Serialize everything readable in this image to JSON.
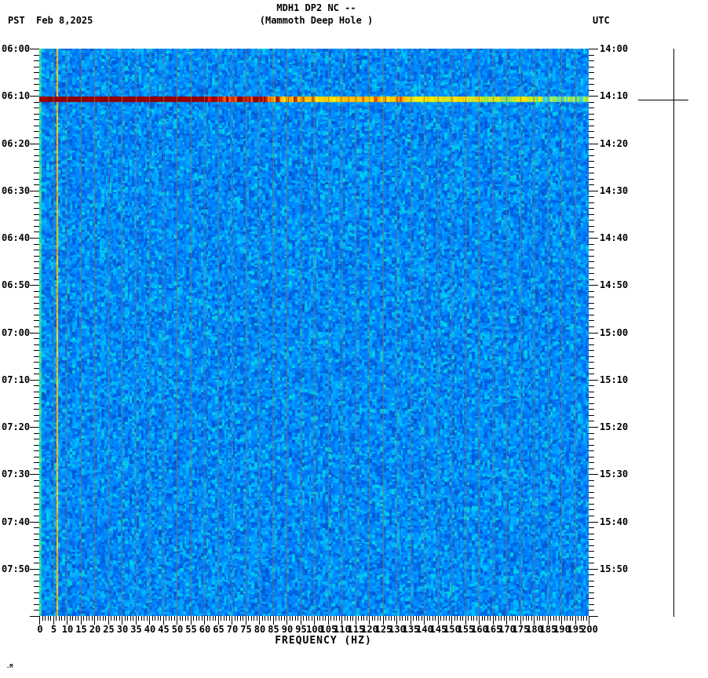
{
  "header": {
    "pst_date_line": "PST  Feb 8,2025",
    "timezone_left": "PST",
    "date": "Feb 8,2025",
    "title_line1": "MDH1 DP2 NC --",
    "title_line2": "(Mammoth Deep Hole )",
    "timezone_right": "UTC"
  },
  "footer": {
    "mark": ".M"
  },
  "chart_data": {
    "type": "heatmap",
    "subtype": "seismic-spectrogram",
    "title": "MDH1 DP2 NC --",
    "subtitle": "(Mammoth Deep Hole )",
    "xlabel": "FREQUENCY (HZ)",
    "x_range_hz": [
      0,
      200
    ],
    "x_label_step_hz": 5,
    "x_minor_tick_hz": 1,
    "freq_labels": [
      "0",
      "5",
      "10",
      "15",
      "20",
      "25",
      "30",
      "35",
      "40",
      "45",
      "50",
      "55",
      "60",
      "65",
      "70",
      "75",
      "80",
      "85",
      "90",
      "95",
      "100",
      "105",
      "110",
      "115",
      "120",
      "125",
      "130",
      "135",
      "140",
      "145",
      "150",
      "155",
      "160",
      "165",
      "170",
      "175",
      "180",
      "185",
      "190",
      "195",
      "200"
    ],
    "left_axis_timezone": "PST",
    "right_axis_timezone": "UTC",
    "left_time_labels": [
      "06:00",
      "06:10",
      "06:20",
      "06:30",
      "06:40",
      "06:50",
      "07:00",
      "07:10",
      "07:20",
      "07:30",
      "07:40",
      "07:50"
    ],
    "right_time_labels": [
      "14:00",
      "14:10",
      "14:20",
      "14:30",
      "14:40",
      "14:50",
      "15:00",
      "15:10",
      "15:20",
      "15:30",
      "15:40",
      "15:50"
    ],
    "time_label_step_min": 10,
    "time_minor_divisions_per_label": 8,
    "noise_colors": [
      "#0070ee",
      "#007cf8",
      "#0088ff",
      "#0094ff",
      "#0062e0",
      "#00a0ff",
      "#0070ee",
      "#0088ff",
      "#0058d4",
      "#00acff",
      "#007cf8",
      "#0094ff",
      "#00c0f8",
      "#0062e0",
      "#0088ff",
      "#00b4ff",
      "#00d2e6"
    ],
    "dc_column_colors": [
      "#2ae6a0",
      "#00dcb4",
      "#50e68c",
      "#00d2c8",
      "#28d2b4"
    ],
    "persistent_tone_hz": 6.4,
    "persistent_tone_colors": [
      "#ffd700",
      "#ffb400",
      "#ffe84b",
      "#f0a000",
      "#d8e000",
      "#ffc81e"
    ],
    "gridline_color": "rgba(122,122,104,0.85)",
    "event": {
      "time_pst": "06:10",
      "time_utc": "14:10",
      "description": "broadband high-amplitude event row spanning 0-200 Hz",
      "color_stops": [
        {
          "to_hz": 61,
          "colors": [
            "#900000",
            "#980000",
            "#8a0000",
            "#a40000",
            "#900000",
            "#960000"
          ]
        },
        {
          "to_hz": 66,
          "colors": [
            "#c80000",
            "#e00000",
            "#940000",
            "#ff1400",
            "#b00000"
          ]
        },
        {
          "to_hz": 83,
          "colors": [
            "#a00000",
            "#d22800",
            "#ff5a00",
            "#960000",
            "#e03c00",
            "#8e0000"
          ]
        },
        {
          "to_hz": 94,
          "colors": [
            "#ff8c00",
            "#ffc800",
            "#d23c00",
            "#ffe100",
            "#b41400"
          ]
        },
        {
          "to_hz": 134,
          "colors": [
            "#ffd200",
            "#ffe600",
            "#ffaa00",
            "#e05a00",
            "#ffee00",
            "#ffc300"
          ]
        },
        {
          "to_hz": 160,
          "colors": [
            "#ffee00",
            "#e6e600",
            "#ffc800",
            "#c8e632",
            "#ffe600"
          ]
        },
        {
          "to_hz": 183,
          "colors": [
            "#c8e632",
            "#96e646",
            "#ffe400",
            "#6ee67d",
            "#d2f000"
          ]
        },
        {
          "to_hz": 201,
          "colors": [
            "#46e6c8",
            "#32dcd2",
            "#96e646",
            "#5affc8",
            "#c8f046",
            "#3cd2dc"
          ]
        }
      ]
    },
    "trace": {
      "color": "#000000"
    }
  }
}
